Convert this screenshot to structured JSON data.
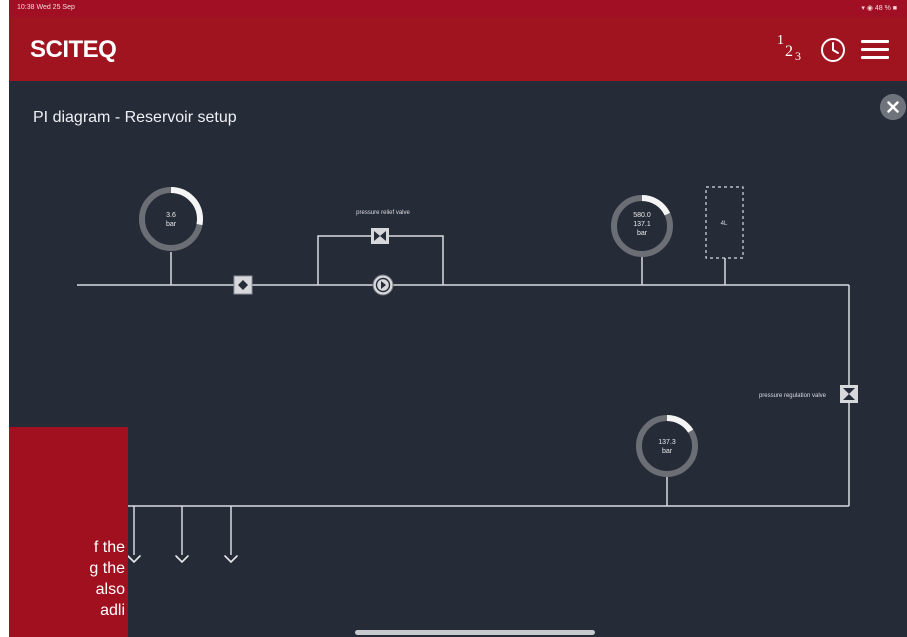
{
  "status_bar": {
    "time": "10:38  Wed 25 Sep",
    "indicators": "▾ ◉ 48 % ■"
  },
  "app": {
    "brand": "SCITEQ",
    "brand_color": "#a0141f",
    "background": "#262b38"
  },
  "toolbar": {
    "numbers_icon": {
      "name": "numbers-icon",
      "glyphs": [
        "1",
        "2",
        "3"
      ]
    },
    "history_icon": "clock-icon",
    "menu_icon": "hamburger-menu-icon"
  },
  "page": {
    "title": "PI diagram - Reservoir setup",
    "close_icon": "close-icon"
  },
  "diagram": {
    "gauges": [
      {
        "id": "inlet",
        "lines": [
          "3.6",
          "bar"
        ],
        "fraction": 0.28
      },
      {
        "id": "reservoir",
        "lines": [
          "580.0",
          "137.1",
          "bar"
        ],
        "fraction": 0.18
      },
      {
        "id": "outlet",
        "lines": [
          "137.3",
          "bar"
        ],
        "fraction": 0.16
      }
    ],
    "valve_labels": {
      "relief": "pressure relief valve",
      "regulation": "pressure regulation valve"
    },
    "components": {
      "check_valve": "diamond-valve-icon",
      "relief_valve": "bowtie-valve-icon",
      "pump": "pump-icon",
      "regulation_valve": "hourglass-valve-icon",
      "outlets": "arrow-down-icon"
    },
    "placeholder_box": "4L"
  },
  "overlay": {
    "lines": [
      "f the",
      "g the",
      "also",
      "adli"
    ]
  }
}
